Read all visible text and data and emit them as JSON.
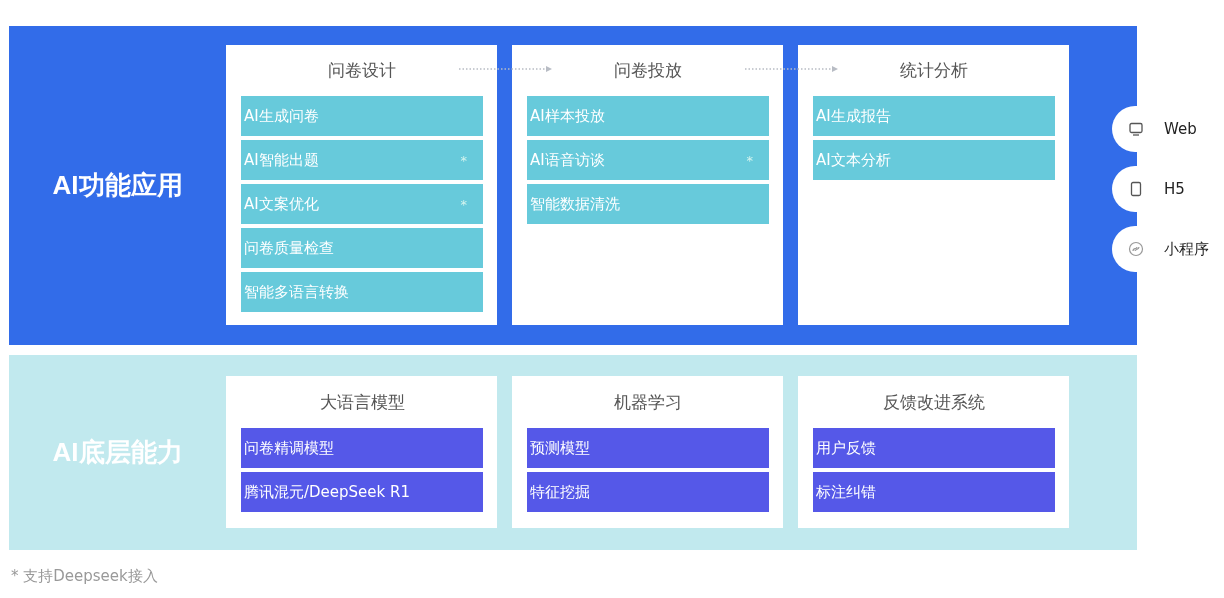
{
  "layers": [
    {
      "kind": "application",
      "title": "AI功能应用",
      "cards": [
        {
          "title": "问卷设计",
          "arrow_after": true,
          "items": [
            {
              "label": "AI生成问卷"
            },
            {
              "label": "AI智能出题",
              "mark": "*"
            },
            {
              "label": "AI文案优化",
              "mark": "*"
            },
            {
              "label": "问卷质量检查"
            },
            {
              "label": "智能多语言转换"
            }
          ]
        },
        {
          "title": "问卷投放",
          "arrow_after": true,
          "items": [
            {
              "label": "AI样本投放"
            },
            {
              "label": "AI语音访谈",
              "mark": "*"
            },
            {
              "label": "智能数据清洗"
            }
          ]
        },
        {
          "title": "统计分析",
          "arrow_after": false,
          "items": [
            {
              "label": "AI生成报告"
            },
            {
              "label": "AI文本分析"
            }
          ]
        }
      ]
    },
    {
      "kind": "foundation",
      "title": "AI底层能力",
      "cards": [
        {
          "title": "大语言模型",
          "arrow_after": false,
          "items": [
            {
              "label": "问卷精调模型"
            },
            {
              "label": "腾讯混元/DeepSeek R1"
            }
          ]
        },
        {
          "title": "机器学习",
          "arrow_after": false,
          "items": [
            {
              "label": "预测模型"
            },
            {
              "label": "特征挖掘"
            }
          ]
        },
        {
          "title": "反馈改进系统",
          "arrow_after": false,
          "items": [
            {
              "label": "用户反馈"
            },
            {
              "label": "标注纠错"
            }
          ]
        }
      ]
    }
  ],
  "platforms": [
    {
      "kind": "monitor",
      "label": "Web"
    },
    {
      "kind": "phone",
      "label": "H5"
    },
    {
      "kind": "miniapp",
      "label": "小程序"
    }
  ],
  "footnote": "* 支持Deepseek接入"
}
